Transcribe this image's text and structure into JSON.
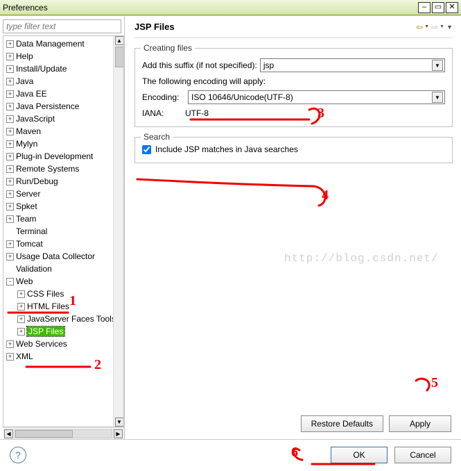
{
  "title": "Preferences",
  "filter_placeholder": "type filter text",
  "tree": [
    {
      "label": "Data Management",
      "depth": 0,
      "expand": "+"
    },
    {
      "label": "Help",
      "depth": 0,
      "expand": "+"
    },
    {
      "label": "Install/Update",
      "depth": 0,
      "expand": "+"
    },
    {
      "label": "Java",
      "depth": 0,
      "expand": "+"
    },
    {
      "label": "Java EE",
      "depth": 0,
      "expand": "+"
    },
    {
      "label": "Java Persistence",
      "depth": 0,
      "expand": "+"
    },
    {
      "label": "JavaScript",
      "depth": 0,
      "expand": "+"
    },
    {
      "label": "Maven",
      "depth": 0,
      "expand": "+"
    },
    {
      "label": "Mylyn",
      "depth": 0,
      "expand": "+"
    },
    {
      "label": "Plug-in Development",
      "depth": 0,
      "expand": "+"
    },
    {
      "label": "Remote Systems",
      "depth": 0,
      "expand": "+"
    },
    {
      "label": "Run/Debug",
      "depth": 0,
      "expand": "+"
    },
    {
      "label": "Server",
      "depth": 0,
      "expand": "+"
    },
    {
      "label": "Spket",
      "depth": 0,
      "expand": "+"
    },
    {
      "label": "Team",
      "depth": 0,
      "expand": "+"
    },
    {
      "label": "Terminal",
      "depth": 0,
      "expand": ""
    },
    {
      "label": "Tomcat",
      "depth": 0,
      "expand": "+"
    },
    {
      "label": "Usage Data Collector",
      "depth": 0,
      "expand": "+"
    },
    {
      "label": "Validation",
      "depth": 0,
      "expand": ""
    },
    {
      "label": "Web",
      "depth": 0,
      "expand": "-"
    },
    {
      "label": "CSS Files",
      "depth": 1,
      "expand": "+"
    },
    {
      "label": "HTML Files",
      "depth": 1,
      "expand": "+"
    },
    {
      "label": "JavaServer Faces Tools",
      "depth": 1,
      "expand": "+"
    },
    {
      "label": "JSP Files",
      "depth": 1,
      "expand": "+",
      "selected": true
    },
    {
      "label": "Web Services",
      "depth": 0,
      "expand": "+"
    },
    {
      "label": "XML",
      "depth": 0,
      "expand": "+"
    }
  ],
  "page": {
    "title": "JSP Files",
    "creating": {
      "legend": "Creating files",
      "suffix_label": "Add this suffix (if not specified):",
      "suffix_value": "jsp",
      "encoding_note": "The following encoding will apply:",
      "encoding_label": "Encoding:",
      "encoding_value": "ISO 10646/Unicode(UTF-8)",
      "iana_label": "IANA:",
      "iana_value": "UTF-8"
    },
    "search": {
      "legend": "Search",
      "include_label": "Include JSP matches in Java searches"
    },
    "watermark": "http://blog.csdn.net/",
    "restore": "Restore Defaults",
    "apply": "Apply"
  },
  "footer": {
    "ok": "OK",
    "cancel": "Cancel"
  },
  "annotations": {
    "n1": "1",
    "n2": "2",
    "n3": "3",
    "n4": "4",
    "n5": "5",
    "n6": "6"
  }
}
